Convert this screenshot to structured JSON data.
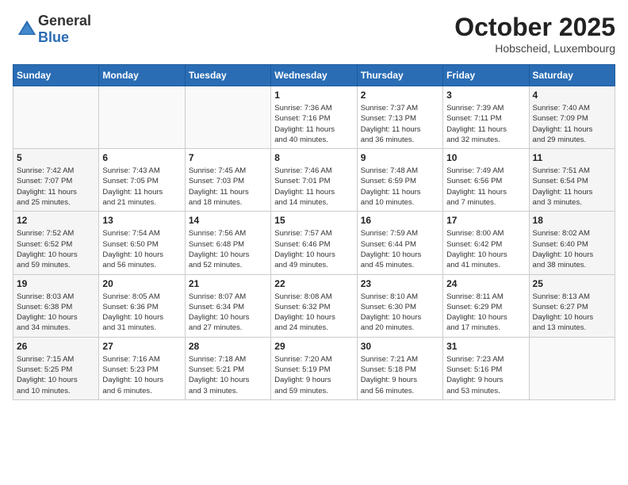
{
  "header": {
    "logo_general": "General",
    "logo_blue": "Blue",
    "month": "October 2025",
    "location": "Hobscheid, Luxembourg"
  },
  "weekdays": [
    "Sunday",
    "Monday",
    "Tuesday",
    "Wednesday",
    "Thursday",
    "Friday",
    "Saturday"
  ],
  "weeks": [
    [
      {
        "day": "",
        "info": ""
      },
      {
        "day": "",
        "info": ""
      },
      {
        "day": "",
        "info": ""
      },
      {
        "day": "1",
        "info": "Sunrise: 7:36 AM\nSunset: 7:16 PM\nDaylight: 11 hours\nand 40 minutes."
      },
      {
        "day": "2",
        "info": "Sunrise: 7:37 AM\nSunset: 7:13 PM\nDaylight: 11 hours\nand 36 minutes."
      },
      {
        "day": "3",
        "info": "Sunrise: 7:39 AM\nSunset: 7:11 PM\nDaylight: 11 hours\nand 32 minutes."
      },
      {
        "day": "4",
        "info": "Sunrise: 7:40 AM\nSunset: 7:09 PM\nDaylight: 11 hours\nand 29 minutes."
      }
    ],
    [
      {
        "day": "5",
        "info": "Sunrise: 7:42 AM\nSunset: 7:07 PM\nDaylight: 11 hours\nand 25 minutes."
      },
      {
        "day": "6",
        "info": "Sunrise: 7:43 AM\nSunset: 7:05 PM\nDaylight: 11 hours\nand 21 minutes."
      },
      {
        "day": "7",
        "info": "Sunrise: 7:45 AM\nSunset: 7:03 PM\nDaylight: 11 hours\nand 18 minutes."
      },
      {
        "day": "8",
        "info": "Sunrise: 7:46 AM\nSunset: 7:01 PM\nDaylight: 11 hours\nand 14 minutes."
      },
      {
        "day": "9",
        "info": "Sunrise: 7:48 AM\nSunset: 6:59 PM\nDaylight: 11 hours\nand 10 minutes."
      },
      {
        "day": "10",
        "info": "Sunrise: 7:49 AM\nSunset: 6:56 PM\nDaylight: 11 hours\nand 7 minutes."
      },
      {
        "day": "11",
        "info": "Sunrise: 7:51 AM\nSunset: 6:54 PM\nDaylight: 11 hours\nand 3 minutes."
      }
    ],
    [
      {
        "day": "12",
        "info": "Sunrise: 7:52 AM\nSunset: 6:52 PM\nDaylight: 10 hours\nand 59 minutes."
      },
      {
        "day": "13",
        "info": "Sunrise: 7:54 AM\nSunset: 6:50 PM\nDaylight: 10 hours\nand 56 minutes."
      },
      {
        "day": "14",
        "info": "Sunrise: 7:56 AM\nSunset: 6:48 PM\nDaylight: 10 hours\nand 52 minutes."
      },
      {
        "day": "15",
        "info": "Sunrise: 7:57 AM\nSunset: 6:46 PM\nDaylight: 10 hours\nand 49 minutes."
      },
      {
        "day": "16",
        "info": "Sunrise: 7:59 AM\nSunset: 6:44 PM\nDaylight: 10 hours\nand 45 minutes."
      },
      {
        "day": "17",
        "info": "Sunrise: 8:00 AM\nSunset: 6:42 PM\nDaylight: 10 hours\nand 41 minutes."
      },
      {
        "day": "18",
        "info": "Sunrise: 8:02 AM\nSunset: 6:40 PM\nDaylight: 10 hours\nand 38 minutes."
      }
    ],
    [
      {
        "day": "19",
        "info": "Sunrise: 8:03 AM\nSunset: 6:38 PM\nDaylight: 10 hours\nand 34 minutes."
      },
      {
        "day": "20",
        "info": "Sunrise: 8:05 AM\nSunset: 6:36 PM\nDaylight: 10 hours\nand 31 minutes."
      },
      {
        "day": "21",
        "info": "Sunrise: 8:07 AM\nSunset: 6:34 PM\nDaylight: 10 hours\nand 27 minutes."
      },
      {
        "day": "22",
        "info": "Sunrise: 8:08 AM\nSunset: 6:32 PM\nDaylight: 10 hours\nand 24 minutes."
      },
      {
        "day": "23",
        "info": "Sunrise: 8:10 AM\nSunset: 6:30 PM\nDaylight: 10 hours\nand 20 minutes."
      },
      {
        "day": "24",
        "info": "Sunrise: 8:11 AM\nSunset: 6:29 PM\nDaylight: 10 hours\nand 17 minutes."
      },
      {
        "day": "25",
        "info": "Sunrise: 8:13 AM\nSunset: 6:27 PM\nDaylight: 10 hours\nand 13 minutes."
      }
    ],
    [
      {
        "day": "26",
        "info": "Sunrise: 7:15 AM\nSunset: 5:25 PM\nDaylight: 10 hours\nand 10 minutes."
      },
      {
        "day": "27",
        "info": "Sunrise: 7:16 AM\nSunset: 5:23 PM\nDaylight: 10 hours\nand 6 minutes."
      },
      {
        "day": "28",
        "info": "Sunrise: 7:18 AM\nSunset: 5:21 PM\nDaylight: 10 hours\nand 3 minutes."
      },
      {
        "day": "29",
        "info": "Sunrise: 7:20 AM\nSunset: 5:19 PM\nDaylight: 9 hours\nand 59 minutes."
      },
      {
        "day": "30",
        "info": "Sunrise: 7:21 AM\nSunset: 5:18 PM\nDaylight: 9 hours\nand 56 minutes."
      },
      {
        "day": "31",
        "info": "Sunrise: 7:23 AM\nSunset: 5:16 PM\nDaylight: 9 hours\nand 53 minutes."
      },
      {
        "day": "",
        "info": ""
      }
    ]
  ]
}
